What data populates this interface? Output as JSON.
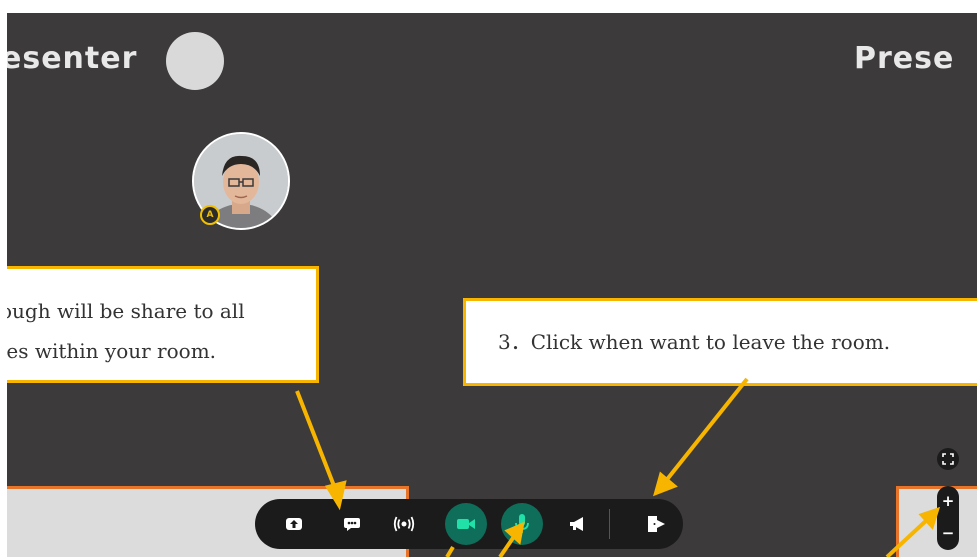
{
  "stage": {
    "presenter_left_label": "esenter",
    "presenter_right_label": "Prese"
  },
  "participant": {
    "badge_letter": "A"
  },
  "callouts": {
    "share_line1": "ough will be share to all",
    "share_line2": "les within your room.",
    "leave_text": "3．Click when want to leave the room."
  },
  "toolbar": {
    "buttons": [
      {
        "icon": "share-screen-icon"
      },
      {
        "icon": "chat-icon"
      },
      {
        "icon": "broadcast-icon"
      },
      {
        "icon": "camera-icon",
        "active": true
      },
      {
        "icon": "microphone-icon",
        "active": true
      },
      {
        "icon": "megaphone-icon"
      },
      {
        "icon": "leave-room-icon"
      }
    ]
  },
  "zoom": {
    "plus_label": "+",
    "minus_label": "−"
  },
  "colors": {
    "stage_bg": "#3c3a3a",
    "callout_border": "#f7b500",
    "room_border": "#e8742a",
    "active_button": "#0f6e5a"
  }
}
